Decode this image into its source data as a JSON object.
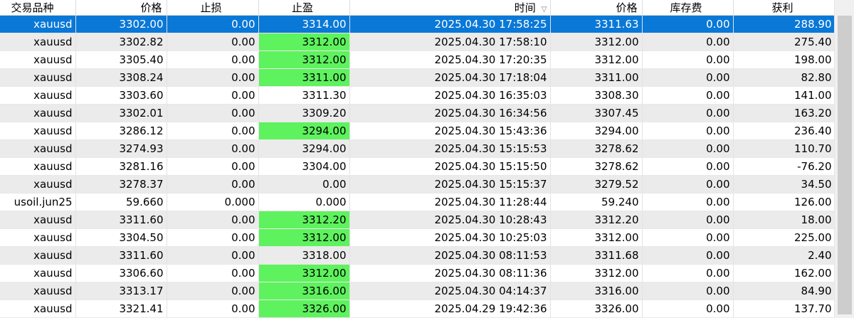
{
  "columns": {
    "symbol": "交易品种",
    "open_price": "价格",
    "stop_loss": "止损",
    "take_profit": "止盈",
    "time": "时间",
    "close_price": "价格",
    "swap": "库存费",
    "profit": "获利"
  },
  "rows": [
    {
      "symbol": "xauusd",
      "open_price": "3302.00",
      "stop_loss": "0.00",
      "take_profit": "3314.00",
      "time": "2025.04.30 17:58:25",
      "close_price": "3311.63",
      "swap": "0.00",
      "profit": "288.90",
      "selected": true,
      "tp_hit": false
    },
    {
      "symbol": "xauusd",
      "open_price": "3302.82",
      "stop_loss": "0.00",
      "take_profit": "3312.00",
      "time": "2025.04.30 17:58:10",
      "close_price": "3312.00",
      "swap": "0.00",
      "profit": "275.40",
      "tp_hit": true
    },
    {
      "symbol": "xauusd",
      "open_price": "3305.40",
      "stop_loss": "0.00",
      "take_profit": "3312.00",
      "time": "2025.04.30 17:20:35",
      "close_price": "3312.00",
      "swap": "0.00",
      "profit": "198.00",
      "tp_hit": true
    },
    {
      "symbol": "xauusd",
      "open_price": "3308.24",
      "stop_loss": "0.00",
      "take_profit": "3311.00",
      "time": "2025.04.30 17:18:04",
      "close_price": "3311.00",
      "swap": "0.00",
      "profit": "82.80",
      "tp_hit": true
    },
    {
      "symbol": "xauusd",
      "open_price": "3303.60",
      "stop_loss": "0.00",
      "take_profit": "3311.30",
      "time": "2025.04.30 16:35:03",
      "close_price": "3308.30",
      "swap": "0.00",
      "profit": "141.00",
      "tp_hit": false
    },
    {
      "symbol": "xauusd",
      "open_price": "3302.01",
      "stop_loss": "0.00",
      "take_profit": "3309.20",
      "time": "2025.04.30 16:34:56",
      "close_price": "3307.45",
      "swap": "0.00",
      "profit": "163.20",
      "tp_hit": false
    },
    {
      "symbol": "xauusd",
      "open_price": "3286.12",
      "stop_loss": "0.00",
      "take_profit": "3294.00",
      "time": "2025.04.30 15:43:36",
      "close_price": "3294.00",
      "swap": "0.00",
      "profit": "236.40",
      "tp_hit": true
    },
    {
      "symbol": "xauusd",
      "open_price": "3274.93",
      "stop_loss": "0.00",
      "take_profit": "3294.00",
      "time": "2025.04.30 15:15:53",
      "close_price": "3278.62",
      "swap": "0.00",
      "profit": "110.70",
      "tp_hit": false
    },
    {
      "symbol": "xauusd",
      "open_price": "3281.16",
      "stop_loss": "0.00",
      "take_profit": "3304.00",
      "time": "2025.04.30 15:15:50",
      "close_price": "3278.62",
      "swap": "0.00",
      "profit": "-76.20",
      "tp_hit": false
    },
    {
      "symbol": "xauusd",
      "open_price": "3278.37",
      "stop_loss": "0.00",
      "take_profit": "0.00",
      "time": "2025.04.30 15:15:37",
      "close_price": "3279.52",
      "swap": "0.00",
      "profit": "34.50",
      "tp_hit": false
    },
    {
      "symbol": "usoil.jun25",
      "open_price": "59.660",
      "stop_loss": "0.000",
      "take_profit": "0.000",
      "time": "2025.04.30 11:28:44",
      "close_price": "59.240",
      "swap": "0.00",
      "profit": "126.00",
      "tp_hit": false
    },
    {
      "symbol": "xauusd",
      "open_price": "3311.60",
      "stop_loss": "0.00",
      "take_profit": "3312.20",
      "time": "2025.04.30 10:28:43",
      "close_price": "3312.20",
      "swap": "0.00",
      "profit": "18.00",
      "tp_hit": true
    },
    {
      "symbol": "xauusd",
      "open_price": "3304.50",
      "stop_loss": "0.00",
      "take_profit": "3312.00",
      "time": "2025.04.30 10:25:03",
      "close_price": "3312.00",
      "swap": "0.00",
      "profit": "225.00",
      "tp_hit": true
    },
    {
      "symbol": "xauusd",
      "open_price": "3311.60",
      "stop_loss": "0.00",
      "take_profit": "3318.00",
      "time": "2025.04.30 08:11:53",
      "close_price": "3311.68",
      "swap": "0.00",
      "profit": "2.40",
      "tp_hit": false
    },
    {
      "symbol": "xauusd",
      "open_price": "3306.60",
      "stop_loss": "0.00",
      "take_profit": "3312.00",
      "time": "2025.04.30 08:11:36",
      "close_price": "3312.00",
      "swap": "0.00",
      "profit": "162.00",
      "tp_hit": true
    },
    {
      "symbol": "xauusd",
      "open_price": "3313.17",
      "stop_loss": "0.00",
      "take_profit": "3316.00",
      "time": "2025.04.30 04:14:37",
      "close_price": "3316.00",
      "swap": "0.00",
      "profit": "84.90",
      "tp_hit": true
    },
    {
      "symbol": "xauusd",
      "open_price": "3321.41",
      "stop_loss": "0.00",
      "take_profit": "3326.00",
      "time": "2025.04.29 19:42:36",
      "close_price": "3326.00",
      "swap": "0.00",
      "profit": "137.70",
      "tp_hit": true
    }
  ],
  "sort_indicator": "sort-descending-icon",
  "colors": {
    "selected_row": "#0a78d7",
    "take_profit_hit": "#5ef25e",
    "alt_row": "#ebebeb"
  }
}
